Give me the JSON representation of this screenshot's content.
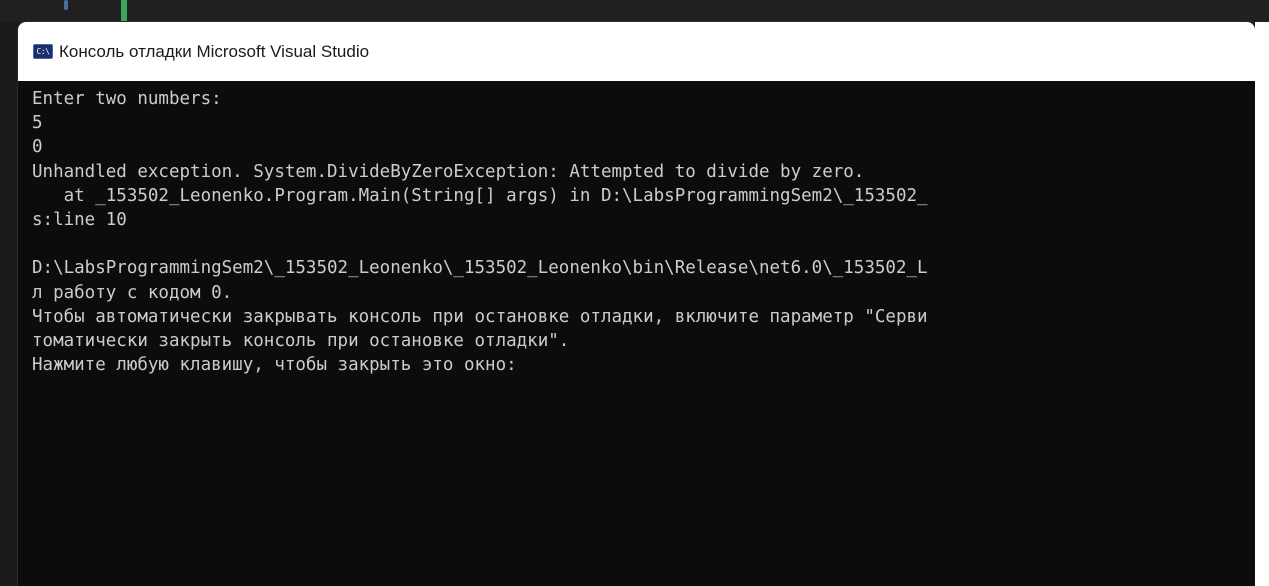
{
  "window": {
    "title": "Консоль отладки Microsoft Visual Studio",
    "icon": "console-app-icon",
    "icon_glyph": "C:\\"
  },
  "console": {
    "lines": [
      "Enter two numbers:",
      "5",
      "0",
      "Unhandled exception. System.DivideByZeroException: Attempted to divide by zero.",
      "   at _153502_Leonenko.Program.Main(String[] args) in D:\\LabsProgrammingSem2\\_153502_",
      "s:line 10",
      "",
      "D:\\LabsProgrammingSem2\\_153502_Leonenko\\_153502_Leonenko\\bin\\Release\\net6.0\\_153502_L",
      "л работу с кодом 0.",
      "Чтобы автоматически закрывать консоль при остановке отладки, включите параметр \"Серви",
      "томатически закрыть консоль при остановке отладки\".",
      "Нажмите любую клавишу, чтобы закрыть это окно:"
    ]
  },
  "colors": {
    "console_background": "#0c0c0c",
    "console_text": "#cccccc",
    "title_bar": "#ffffff",
    "ide_accent_green": "#3ba55c"
  }
}
